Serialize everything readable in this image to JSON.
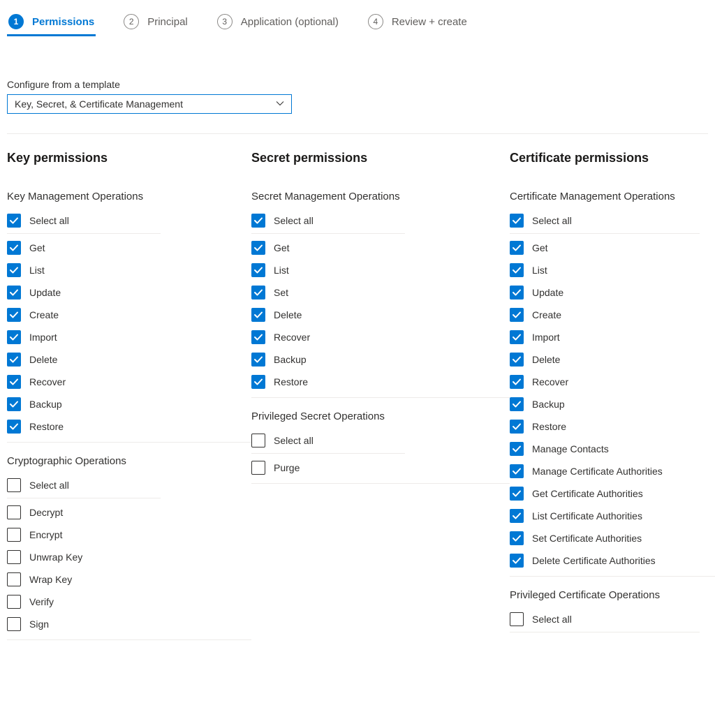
{
  "stepper": [
    {
      "num": "1",
      "label": "Permissions",
      "active": true
    },
    {
      "num": "2",
      "label": "Principal",
      "active": false
    },
    {
      "num": "3",
      "label": "Application (optional)",
      "active": false
    },
    {
      "num": "4",
      "label": "Review + create",
      "active": false
    }
  ],
  "template": {
    "label": "Configure from a template",
    "value": "Key, Secret, & Certificate Management"
  },
  "columns": [
    {
      "title": "Key permissions",
      "groups": [
        {
          "heading": "Key Management Operations",
          "selectAllLabel": "Select all",
          "selectAllChecked": true,
          "items": [
            {
              "label": "Get",
              "checked": true
            },
            {
              "label": "List",
              "checked": true
            },
            {
              "label": "Update",
              "checked": true
            },
            {
              "label": "Create",
              "checked": true
            },
            {
              "label": "Import",
              "checked": true
            },
            {
              "label": "Delete",
              "checked": true
            },
            {
              "label": "Recover",
              "checked": true
            },
            {
              "label": "Backup",
              "checked": true
            },
            {
              "label": "Restore",
              "checked": true
            }
          ]
        },
        {
          "heading": "Cryptographic Operations",
          "selectAllLabel": "Select all",
          "selectAllChecked": false,
          "items": [
            {
              "label": "Decrypt",
              "checked": false
            },
            {
              "label": "Encrypt",
              "checked": false
            },
            {
              "label": "Unwrap Key",
              "checked": false
            },
            {
              "label": "Wrap Key",
              "checked": false
            },
            {
              "label": "Verify",
              "checked": false
            },
            {
              "label": "Sign",
              "checked": false
            }
          ]
        }
      ]
    },
    {
      "title": "Secret permissions",
      "groups": [
        {
          "heading": "Secret Management Operations",
          "selectAllLabel": "Select all",
          "selectAllChecked": true,
          "items": [
            {
              "label": "Get",
              "checked": true
            },
            {
              "label": "List",
              "checked": true
            },
            {
              "label": "Set",
              "checked": true
            },
            {
              "label": "Delete",
              "checked": true
            },
            {
              "label": "Recover",
              "checked": true
            },
            {
              "label": "Backup",
              "checked": true
            },
            {
              "label": "Restore",
              "checked": true
            }
          ]
        },
        {
          "heading": "Privileged Secret Operations",
          "selectAllLabel": "Select all",
          "selectAllChecked": false,
          "items": [
            {
              "label": "Purge",
              "checked": false
            }
          ]
        }
      ]
    },
    {
      "title": "Certificate permissions",
      "groups": [
        {
          "heading": "Certificate Management Operations",
          "selectAllLabel": "Select all",
          "selectAllChecked": true,
          "items": [
            {
              "label": "Get",
              "checked": true
            },
            {
              "label": "List",
              "checked": true
            },
            {
              "label": "Update",
              "checked": true
            },
            {
              "label": "Create",
              "checked": true
            },
            {
              "label": "Import",
              "checked": true
            },
            {
              "label": "Delete",
              "checked": true
            },
            {
              "label": "Recover",
              "checked": true
            },
            {
              "label": "Backup",
              "checked": true
            },
            {
              "label": "Restore",
              "checked": true
            },
            {
              "label": "Manage Contacts",
              "checked": true
            },
            {
              "label": "Manage Certificate Authorities",
              "checked": true
            },
            {
              "label": "Get Certificate Authorities",
              "checked": true
            },
            {
              "label": "List Certificate Authorities",
              "checked": true
            },
            {
              "label": "Set Certificate Authorities",
              "checked": true
            },
            {
              "label": "Delete Certificate Authorities",
              "checked": true
            }
          ]
        },
        {
          "heading": "Privileged Certificate Operations",
          "selectAllLabel": "Select all",
          "selectAllChecked": false,
          "items": []
        }
      ]
    }
  ]
}
